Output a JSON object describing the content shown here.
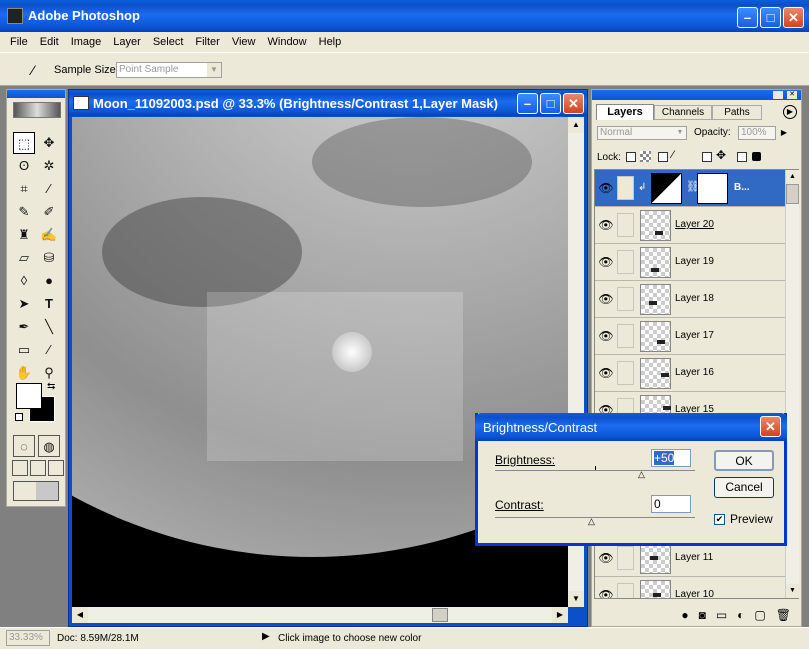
{
  "app": {
    "title": "Adobe Photoshop"
  },
  "menu": [
    "File",
    "Edit",
    "Image",
    "Layer",
    "Select",
    "Filter",
    "View",
    "Window",
    "Help"
  ],
  "options": {
    "sample_size_label": "Sample Size:",
    "sample_size_value": "Point Sample"
  },
  "document": {
    "title": "Moon_11092003.psd @ 33.3% (Brightness/Contrast 1,Layer Mask)"
  },
  "layers_panel": {
    "tabs": [
      "Layers",
      "Channels",
      "Paths"
    ],
    "blend_mode": "Normal",
    "opacity_label": "Opacity:",
    "opacity_value": "100%",
    "lock_label": "Lock:",
    "adjustment_layer_name": "B...",
    "layers": [
      "Layer 20",
      "Layer 19",
      "Layer 18",
      "Layer 17",
      "Layer 16",
      "Layer 15",
      "Layer 11",
      "Layer 10"
    ]
  },
  "dialog": {
    "title": "Brightness/Contrast",
    "brightness_label": "Brightness:",
    "brightness_value": "+50",
    "contrast_label": "Contrast:",
    "contrast_value": "0",
    "ok_label": "OK",
    "cancel_label": "Cancel",
    "preview_label": "Preview",
    "preview_checked": true
  },
  "status": {
    "zoom": "33.33%",
    "doc_info": "Doc: 8.59M/28.1M",
    "hint": "Click image to choose new color"
  }
}
